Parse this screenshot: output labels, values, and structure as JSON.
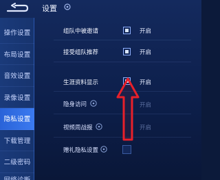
{
  "header": {
    "title": "设置"
  },
  "sidebar": {
    "items": [
      {
        "label": "操作设置"
      },
      {
        "label": "布局设置"
      },
      {
        "label": "音效设置"
      },
      {
        "label": "录像设置"
      },
      {
        "label": "隐私设置"
      },
      {
        "label": "下载管理"
      },
      {
        "label": "二级密码"
      },
      {
        "label": "网络诊断"
      }
    ],
    "active_index": 4
  },
  "settings": {
    "rows": [
      {
        "label": "组队中被邀请",
        "checked": true,
        "state_label": "开启"
      },
      {
        "label": "接受组队推荐",
        "checked": true,
        "state_label": "开启"
      },
      {
        "label": "生涯资料显示",
        "checked": true,
        "state_label": "开启"
      },
      {
        "label": "隐身访问",
        "checked": false,
        "state_label": "开启"
      },
      {
        "label": "视频周战报",
        "checked": false,
        "state_label": "开启"
      },
      {
        "label": "赠礼隐私设置",
        "checked": false,
        "state_label": ""
      }
    ]
  },
  "colors": {
    "accent": "#3b7af0",
    "arrow": "#e8202a",
    "background": "#0d1f4b"
  },
  "icons": [
    "back-icon",
    "gear-icon",
    "help-icon",
    "up-arrow-annotation"
  ]
}
